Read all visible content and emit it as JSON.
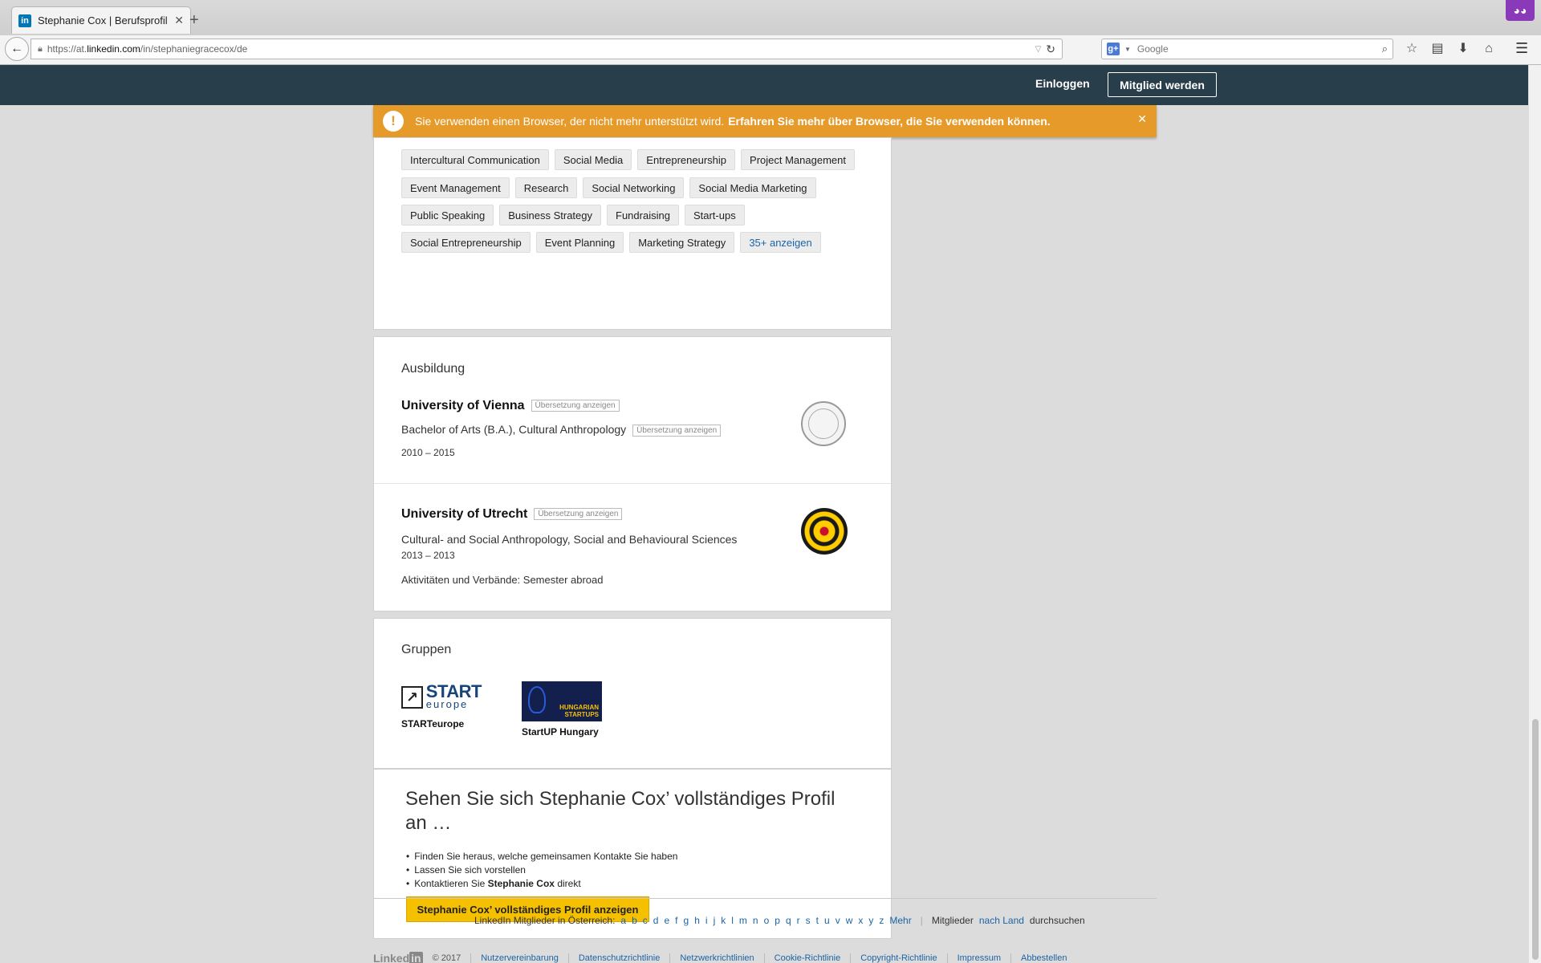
{
  "browser": {
    "tab_title": "Stephanie Cox | Berufsprofil",
    "tab_icon": "in",
    "url_prefix": "https://at.",
    "url_host": "linkedin.com",
    "url_path": "/in/stephaniegracecox/de",
    "search_placeholder": "Google",
    "search_engine_icon": "g+"
  },
  "header": {
    "login": "Einloggen",
    "join": "Mitglied werden"
  },
  "warning": {
    "text": "Sie verwenden einen Browser, der nicht mehr unterstützt wird.",
    "link": "Erfahren Sie mehr über Browser, die Sie verwenden können."
  },
  "skills": {
    "rows": [
      [
        "Intercultural Communication",
        "Social Media",
        "Entrepreneurship",
        "Project Management"
      ],
      [
        "Event Management",
        "Research",
        "Social Networking",
        "Social Media Marketing"
      ],
      [
        "Public Speaking",
        "Business Strategy",
        "Fundraising",
        "Start-ups"
      ],
      [
        "Social Entrepreneurship",
        "Event Planning",
        "Marketing Strategy"
      ]
    ],
    "more": "35+ anzeigen"
  },
  "education": {
    "title": "Ausbildung",
    "translate": "Übersetzung anzeigen",
    "schools": [
      {
        "name": "University of Vienna",
        "degree": "Bachelor of Arts (B.A.), Cultural Anthropology",
        "dates": "2010 – 2015"
      },
      {
        "name": "University of Utrecht",
        "degree": "Cultural- and Social Anthropology, Social and Behavioural Sciences",
        "dates": "2013 – 2013",
        "activities": "Aktivitäten und Verbände: Semester abroad"
      }
    ]
  },
  "groups": {
    "title": "Gruppen",
    "items": [
      {
        "name": "STARTeurope",
        "logo_top": "START",
        "logo_bottom": "europe"
      },
      {
        "name": "StartUP Hungary",
        "logo_line1": "HUNGARIAN",
        "logo_line2": "STARTUPS"
      }
    ]
  },
  "cta": {
    "title": "Sehen Sie sich Stephanie Cox’ vollständiges Profil an …",
    "bullets": [
      "Finden Sie heraus, welche gemeinsamen Kontakte Sie haben",
      "Lassen Sie sich vorstellen"
    ],
    "contact_prefix": "Kontaktieren Sie",
    "contact_name": "Stephanie Cox",
    "contact_suffix": "direkt",
    "button": "Stephanie Cox’ vollständiges Profil anzeigen"
  },
  "footer": {
    "directory_label": "LinkedIn Mitglieder in Österreich:",
    "letters": [
      "a",
      "b",
      "c",
      "d",
      "e",
      "f",
      "g",
      "h",
      "i",
      "j",
      "k",
      "l",
      "m",
      "n",
      "o",
      "p",
      "q",
      "r",
      "s",
      "t",
      "u",
      "v",
      "w",
      "x",
      "y",
      "z"
    ],
    "more": "Mehr",
    "members": "Mitglieder",
    "by_country": "nach Land",
    "search": "durchsuchen",
    "copyright": "© 2017",
    "legal_links": [
      "Nutzervereinbarung",
      "Datenschutzrichtlinie",
      "Netzwerkrichtlinien",
      "Cookie-Richtlinie",
      "Copyright-Richtlinie",
      "Impressum",
      "Abbestellen"
    ]
  },
  "colors": {
    "header_bg": "#283e4a",
    "warning_bg": "#e69a2a",
    "link": "#1a64a5",
    "cta_button": "#f5c000"
  }
}
